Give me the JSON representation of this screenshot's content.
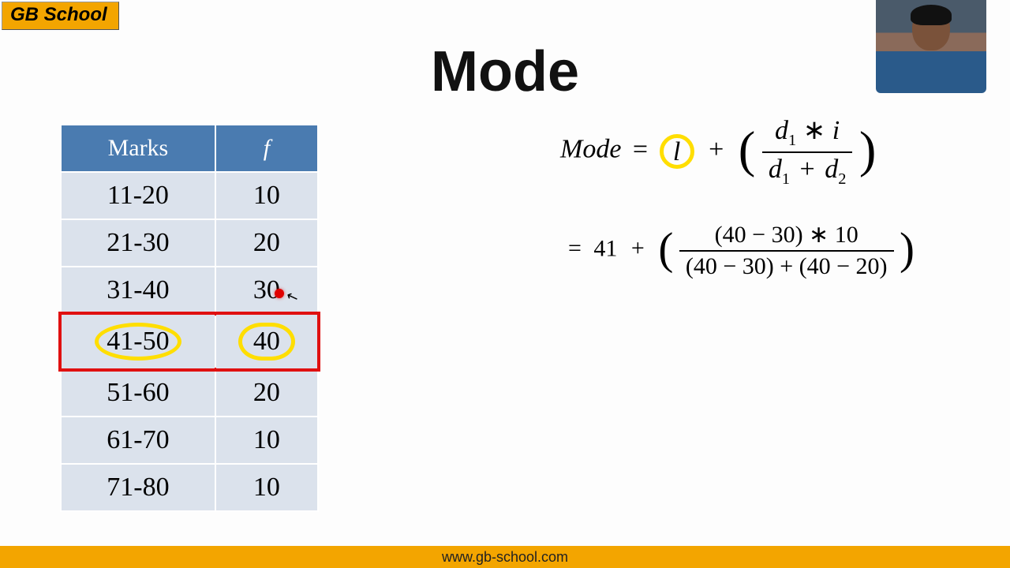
{
  "logo": "GB School",
  "title": "Mode",
  "table": {
    "headers": {
      "marks": "Marks",
      "freq": "f"
    },
    "rows": [
      {
        "marks": "11-20",
        "f": "10"
      },
      {
        "marks": "21-30",
        "f": "20"
      },
      {
        "marks": "31-40",
        "f": "30"
      },
      {
        "marks": "41-50",
        "f": "40",
        "modal": true
      },
      {
        "marks": "51-60",
        "f": "20"
      },
      {
        "marks": "61-70",
        "f": "10"
      },
      {
        "marks": "71-80",
        "f": "10"
      }
    ]
  },
  "formula1": {
    "lhs": "Mode",
    "eq": "=",
    "l": "l",
    "plus": "+",
    "num": "d₁ ∗ i",
    "den": "d₁ + d₂",
    "d": "d",
    "one": "1",
    "two": "2",
    "i": "i",
    "star": "∗",
    "plus2": "+"
  },
  "formula2": {
    "eq": "=",
    "l_val": "41",
    "plus": "+",
    "num": "(40 − 30) ∗ 10",
    "den": "(40 − 30) + (40 − 20)"
  },
  "footer": "www.gb-school.com",
  "chart_data": {
    "type": "table",
    "title": "Mode",
    "columns": [
      "Marks",
      "f"
    ],
    "rows": [
      [
        "11-20",
        10
      ],
      [
        "21-30",
        20
      ],
      [
        "31-40",
        30
      ],
      [
        "41-50",
        40
      ],
      [
        "51-60",
        20
      ],
      [
        "61-70",
        10
      ],
      [
        "71-80",
        10
      ]
    ],
    "modal_class_index": 3,
    "mode_formula": "Mode = l + (d1 * i) / (d1 + d2)",
    "substitution": {
      "l": 41,
      "d1_expr": "40 - 30",
      "d2_expr": "40 - 20",
      "i": 10,
      "expression": "41 + ((40 - 30) * 10) / ((40 - 30) + (40 - 20))"
    }
  }
}
